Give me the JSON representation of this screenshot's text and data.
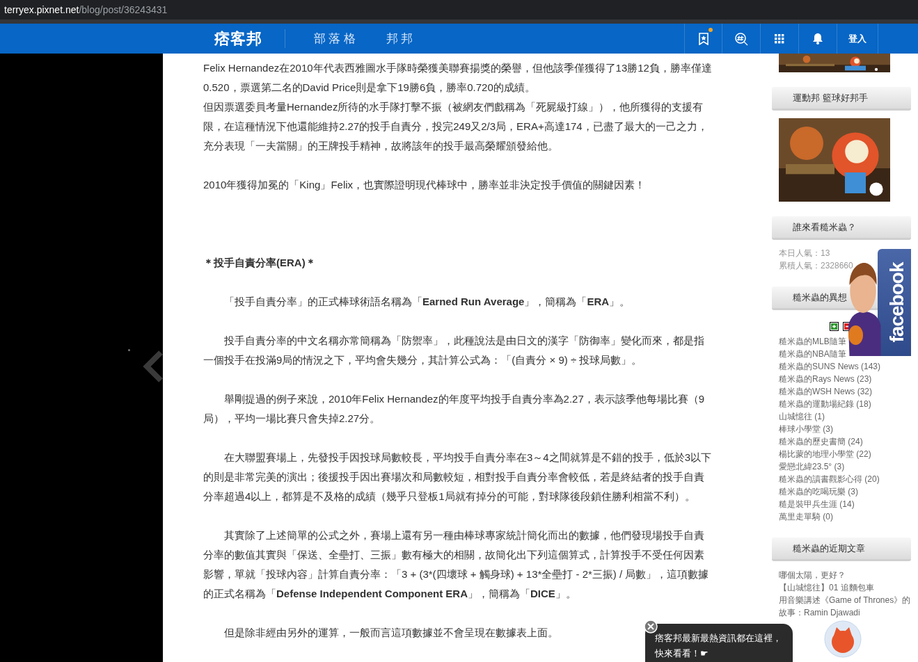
{
  "address_bar": {
    "host": "terryex.pixnet.net",
    "path": "/blog/post/36243431"
  },
  "header": {
    "logo": "痞客邦",
    "nav": [
      {
        "label": "部落格"
      },
      {
        "label": "邦邦"
      }
    ],
    "bookmark_badge": true,
    "login": "登入"
  },
  "article": {
    "blocks": [
      {
        "kind": "plain",
        "text": "Felix Hernandez在2010年代表西雅圖水手隊時榮獲美聯賽揚獎的榮譽，但他該季僅獲得了13勝12負，勝率僅達0.520，票選第二名的David Price則是拿下19勝6負，勝率0.720的成績。"
      },
      {
        "kind": "continued",
        "text": "但因票選委員考量Hernandez所待的水手隊打擊不振（被網友們戲稱為「死屍級打線」），他所獲得的支援有限，在這種情況下他還能維持2.27的投手自責分，投完249又2/3局，ERA+高達174，已盡了最大的一己之力，充分表現「一夫當關」的王牌投手精神，故將該年的投手最高榮耀頒發給他。"
      },
      {
        "kind": "plain",
        "text": "2010年獲得加冕的「King」Felix，也實際證明現代棒球中，勝率並非決定投手價值的關鍵因素！"
      },
      {
        "kind": "heading",
        "text": "＊投手自責分率(ERA)＊"
      },
      {
        "kind": "indented",
        "text": "「投手自責分率」的正式棒球術語名稱為「**Earned Run Average**」，簡稱為「**ERA**」。"
      },
      {
        "kind": "indented",
        "text": "投手自責分率的中文名稱亦常簡稱為「防禦率」，此種說法是由日文的漢字「防御率」變化而來，都是指一個投手在投滿9局的情況之下，平均會失幾分，其計算公式為：「(自責分 × 9) ÷ 投球局數」。"
      },
      {
        "kind": "indented",
        "text": "舉剛提過的例子來說，2010年Felix Hernandez的年度平均投手自責分率為2.27，表示該季他每場比賽（9局），平均一場比賽只會失掉2.27分。"
      },
      {
        "kind": "indented",
        "text": "在大聯盟賽場上，先發投手因投球局數較長，平均投手自責分率在3～4之間就算是不錯的投手，低於3以下的則是非常完美的演出；後援投手因出賽場次和局數較短，相對投手自責分率會較低，若是終結者的投手自責分率超過4以上，都算是不及格的成績（幾乎只登板1局就有掉分的可能，對球隊後段鎖住勝利相當不利）。"
      },
      {
        "kind": "indented",
        "text": "其實除了上述簡單的公式之外，賽場上還有另一種由棒球專家統計簡化而出的數據，他們發現場投手自責分率的數值其實與「保送、全壘打、三振」數有極大的相關，故簡化出下列這個算式，計算投手不受任何因素影響，單就「投球內容」計算自責分率：「3 + (3*(四壞球 + 觸身球) + 13*全壘打 - 2*三振) / 局數」，這項數據的正式名稱為「**Defense Independent Component ERA**」，簡稱為「**DICE**」。"
      },
      {
        "kind": "indented",
        "text": "但是除非經由另外的運算，一般而言這項數據並不會呈現在數據表上面。"
      }
    ]
  },
  "sidebar": {
    "sections": [
      {
        "kind": "picture"
      },
      {
        "kind": "header",
        "title": "運動邦 籃球好邦手"
      },
      {
        "kind": "picture"
      },
      {
        "kind": "header",
        "title": "誰來看糙米蟲？"
      },
      {
        "kind": "stats",
        "lines": [
          "本日人氣：13",
          "累積人氣：2328660"
        ]
      },
      {
        "kind": "header",
        "title": "糙米蟲的異想"
      },
      {
        "kind": "toggles"
      },
      {
        "kind": "links",
        "items": [
          "糙米蟲的MLB隨筆",
          "糙米蟲的NBA隨筆",
          "糙米蟲的SUNS News (143)",
          "糙米蟲的Rays News (23)",
          "糙米蟲的WSH News (32)",
          "糙米蟲的運動場紀錄 (18)",
          "山城憶往 (1)",
          "棒球小學堂 (3)",
          "糙米蟲的歷史書簡 (24)",
          "楊比蒙的地理小學堂 (22)",
          "愛戀北緯23.5° (3)",
          "糙米蟲的讀書觀影心得 (20)",
          "糙米蟲的吃喝玩樂 (3)",
          "糙是裝甲兵生涯 (14)",
          "萬里走單騎 (0)"
        ]
      },
      {
        "kind": "header",
        "title": "糙米蟲的近期文章"
      },
      {
        "kind": "links",
        "items": [
          "哪個太陽，更好？",
          "【山城憶往】01 追麵包車",
          "用音樂講述《Game of Thrones》的故事：Ramin Djawadi"
        ]
      }
    ]
  },
  "facebook": {
    "label": "facebook"
  },
  "toast": {
    "message": "痞客邦最新最熱資訊都在這裡，快來看看！☛"
  }
}
